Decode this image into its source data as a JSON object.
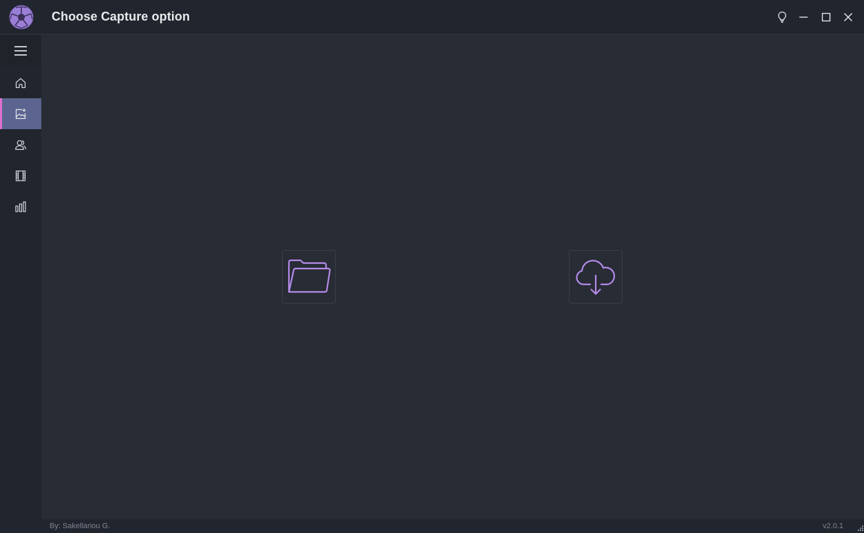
{
  "window": {
    "title": "Choose Capture option",
    "icons": {
      "app_logo": "soccer-ball-icon",
      "theme": "lightbulb-icon",
      "minimize": "minimize-icon",
      "maximize": "maximize-icon",
      "close": "close-icon"
    }
  },
  "sidebar": {
    "menu_icon": "hamburger-menu-icon",
    "items": [
      {
        "name": "home",
        "icon": "home-icon",
        "active": false
      },
      {
        "name": "capture",
        "icon": "image-add-icon",
        "active": true
      },
      {
        "name": "players",
        "icon": "people-icon",
        "active": false
      },
      {
        "name": "videos",
        "icon": "film-icon",
        "active": false
      },
      {
        "name": "statistics",
        "icon": "bar-chart-icon",
        "active": false
      }
    ]
  },
  "main": {
    "options": [
      {
        "name": "open-local-folder",
        "icon": "folder-open-icon"
      },
      {
        "name": "cloud-download",
        "icon": "cloud-download-icon"
      }
    ]
  },
  "footer": {
    "author": "By: Sakellariou G.",
    "version": "v2.0.1"
  },
  "colors": {
    "background": "#282c35",
    "sidebar": "#21252d",
    "accent": "#b48ae8",
    "active_item": "#5b6590",
    "active_marker": "#e06fd0"
  }
}
